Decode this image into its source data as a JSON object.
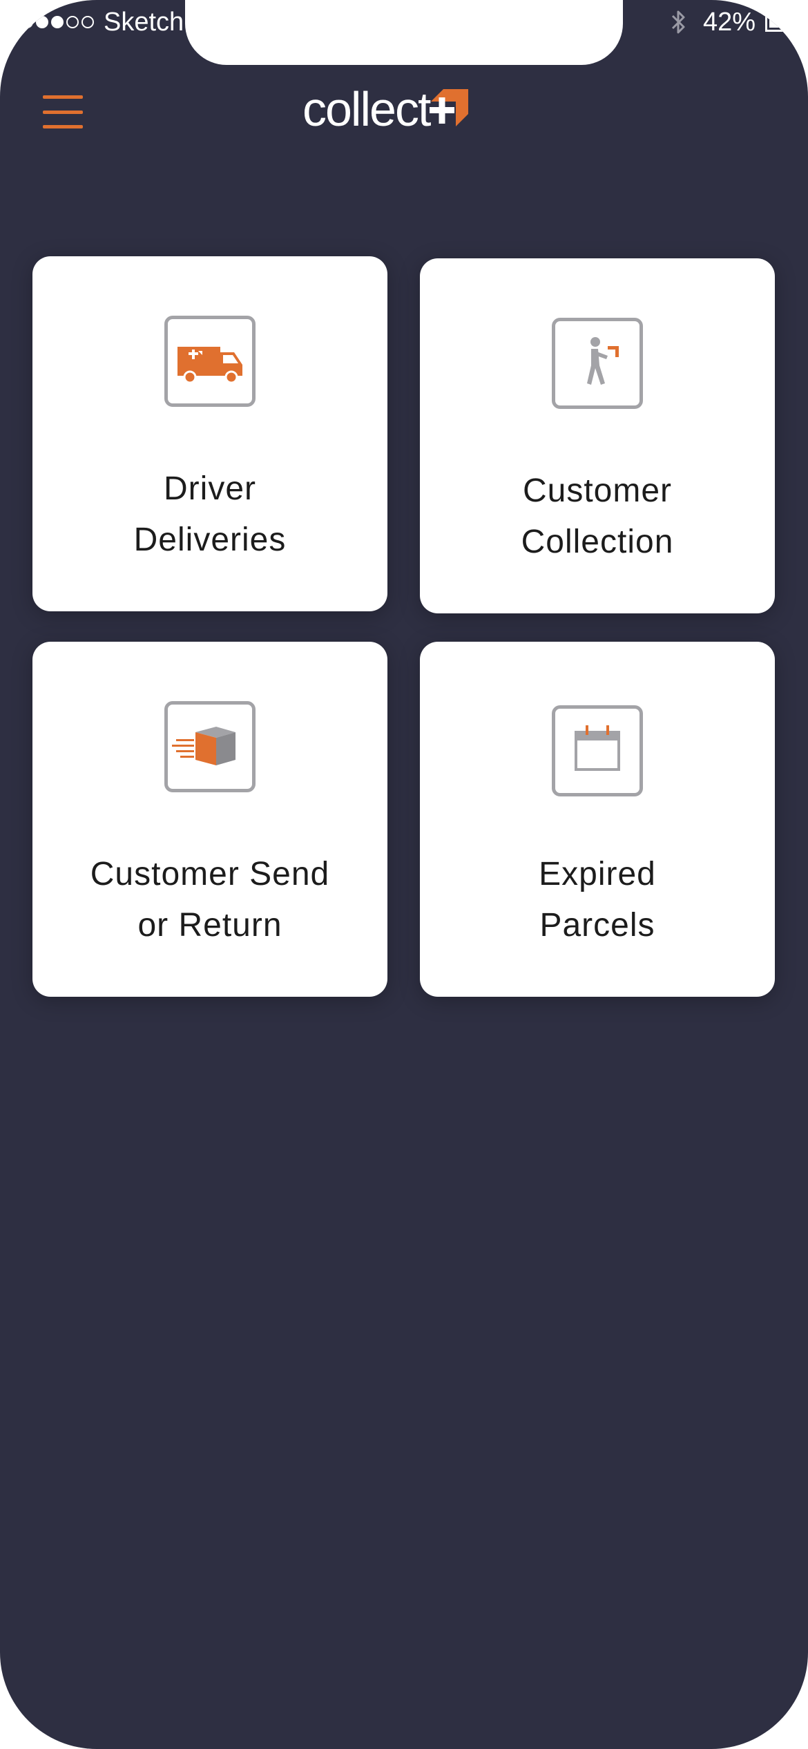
{
  "status_bar": {
    "carrier": "Sketch",
    "battery_percent": "42%",
    "signal_bars_full": 2,
    "signal_bars_total": 5,
    "battery_level": 0.42
  },
  "header": {
    "logo_text": "collect",
    "brand_color": "#e0702f",
    "menu_icon": "hamburger-menu-icon"
  },
  "tiles": [
    {
      "line1": "Driver",
      "line2": "Deliveries",
      "icon": "delivery-van-icon"
    },
    {
      "line1": "Customer",
      "line2": "Collection",
      "icon": "person-carrying-parcel-icon"
    },
    {
      "line1": "Customer Send",
      "line2": "or Return",
      "icon": "parcel-send-icon"
    },
    {
      "line1": "Expired",
      "line2": "Parcels",
      "icon": "calendar-icon"
    }
  ],
  "colors": {
    "background": "#2e2f42",
    "tile": "#ffffff",
    "accent": "#e0702f",
    "icon_gray": "#a3a3a7"
  }
}
